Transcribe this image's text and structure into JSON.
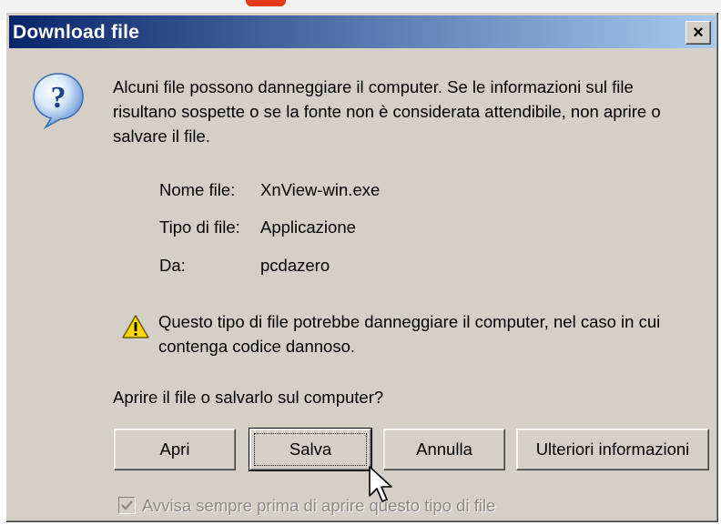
{
  "window": {
    "title": "Download file",
    "close_symbol": "×"
  },
  "message": {
    "icon": "question-icon",
    "text": "Alcuni file possono danneggiare il computer. Se le informazioni sul file risultano sospette o se la fonte non è considerata attendibile, non aprire o salvare il file."
  },
  "file_info": {
    "name_label": "Nome file:",
    "name_value": "XnView-win.exe",
    "type_label": "Tipo di file:",
    "type_value": "Applicazione",
    "from_label": "Da:",
    "from_value": "pcdazero"
  },
  "warning": {
    "icon": "warning-icon",
    "text": "Questo tipo di file potrebbe danneggiare il computer, nel caso in cui contenga codice dannoso."
  },
  "question": "Aprire il file o salvarlo sul computer?",
  "buttons": {
    "open": "Apri",
    "save": "Salva",
    "cancel": "Annulla",
    "more_info": "Ulteriori informazioni"
  },
  "checkbox": {
    "label": "Avvisa sempre prima di aprire questo tipo di file",
    "checked": true,
    "disabled": true
  },
  "colors": {
    "titlebar_start": "#0a246a",
    "titlebar_end": "#a6caf0",
    "dialog_bg": "#d4d0c8",
    "disabled_text": "#8c8a84"
  }
}
